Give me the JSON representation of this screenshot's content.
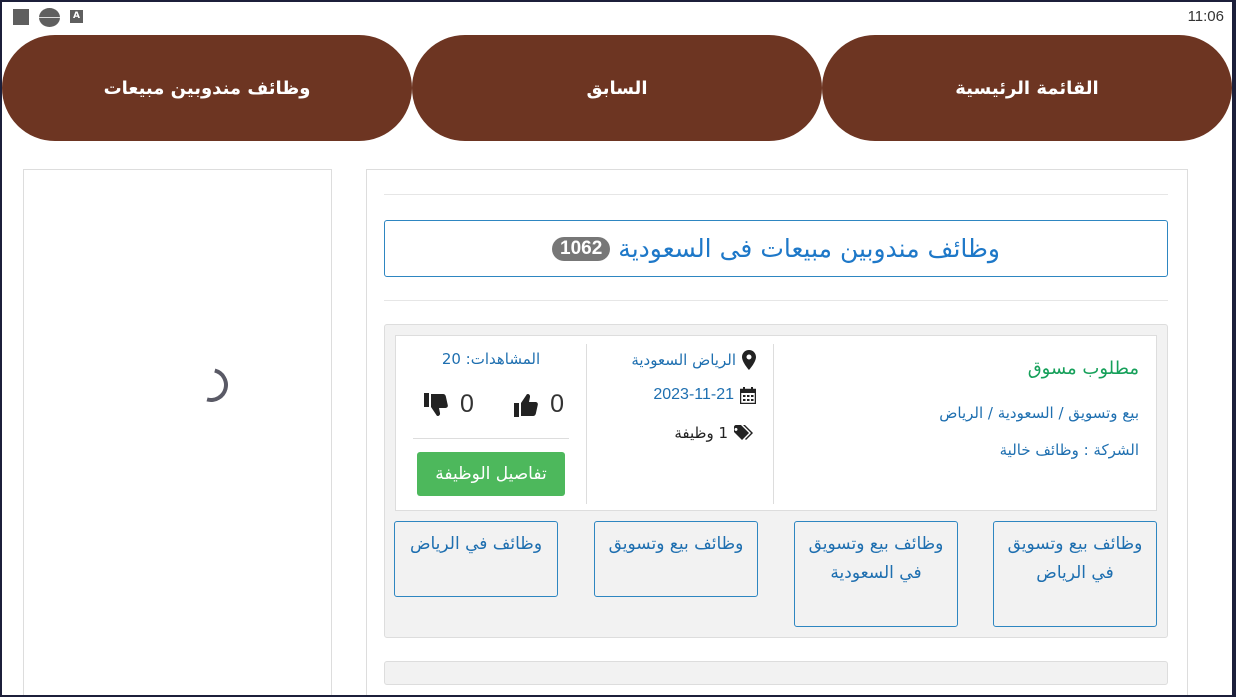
{
  "status_bar": {
    "time": "11:06",
    "icons": [
      "square-icon",
      "circle-icon",
      "a-icon"
    ]
  },
  "nav": {
    "home_label": "القائمة الرئيسية",
    "prev_label": "السابق",
    "category_label": "وظائف مندوبين مبيعات"
  },
  "colors": {
    "nav_bg": "#6d3522",
    "accent_blue": "#1e78c8",
    "green_title": "#16a05a",
    "button_green": "#4db85c"
  },
  "page": {
    "title": "وظائف مندوبين مبيعات فى السعودية",
    "count": "1062"
  },
  "listing": {
    "job_title": "مطلوب مسوق",
    "path": "بيع وتسويق / السعودية / الرياض",
    "company": "الشركة : وظائف خالية",
    "location": "الرياض السعودية",
    "date": "2023-11-21",
    "jobs_count": "1 وظيفة",
    "views": "المشاهدات: 20",
    "likes": "0",
    "dislikes": "0",
    "details_label": "تفاصيل الوظيفة"
  },
  "tags": [
    "وظائف بيع وتسويق في الرياض",
    "وظائف بيع وتسويق في السعودية",
    "وظائف بيع وتسويق",
    "وظائف في الرياض"
  ]
}
